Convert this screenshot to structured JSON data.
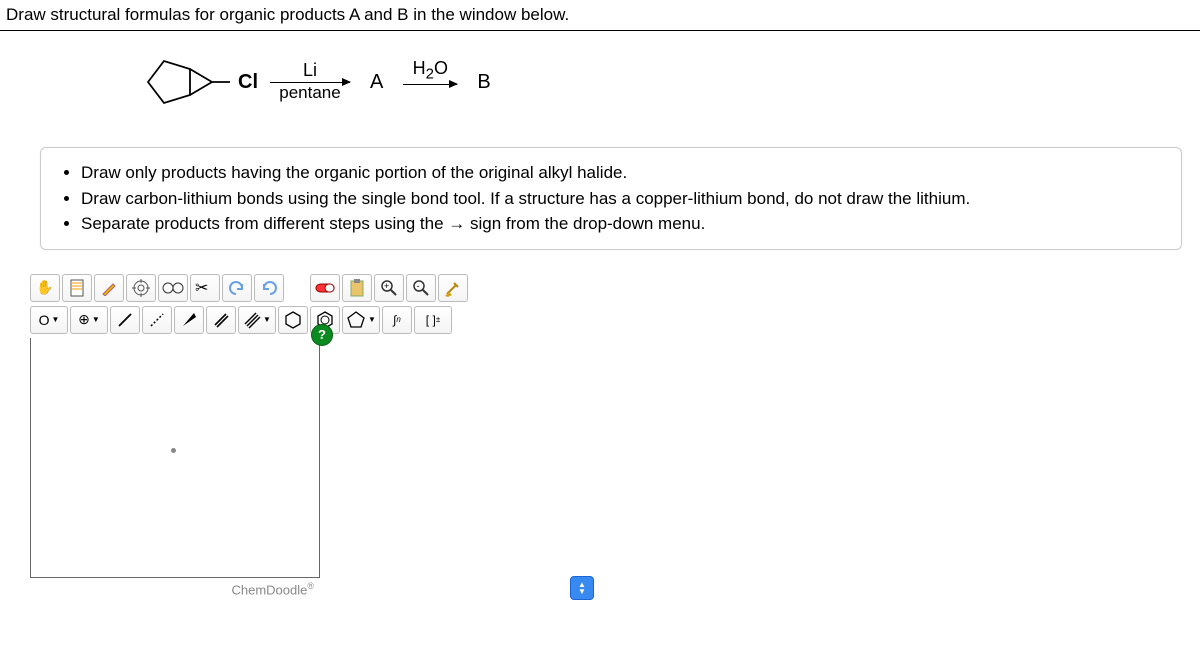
{
  "header": {
    "question": "Draw structural formulas for organic products A and B in the window below."
  },
  "scheme": {
    "reactant_label": "Cl",
    "arrow1_top": "Li",
    "arrow1_bottom": "pentane",
    "product_A": "A",
    "arrow2_top": "H₂O",
    "product_B": "B"
  },
  "instructions": {
    "items": [
      "Draw only products having the organic portion of the original alkyl halide.",
      "Draw carbon-lithium bonds using the single bond tool. If a structure has a copper-lithium bond, do not draw the lithium.",
      "Separate products from different steps using the → sign from the drop-down menu."
    ]
  },
  "toolbar_row1": {
    "hand": "✋",
    "doc": "📄",
    "pencil": "✏",
    "target": "⊛",
    "glasses": "👓",
    "scissors": "✂",
    "undo": "↶",
    "redo": "↷",
    "spacer": "",
    "pill": "💊",
    "paste": "📋",
    "zoomin": "🔍",
    "zoomout": "🔍",
    "broom": "🧹"
  },
  "toolbar_row2": {
    "elem_O": "O",
    "drop1": "▾",
    "plus": "⊕",
    "drop2": "▾",
    "single": "╱",
    "wedge_dot": "⋰",
    "wedge": "◢",
    "double_slash": "⫽",
    "triple": "⫻",
    "drop3": "▾",
    "hex": "⬡",
    "hexf": "⬢",
    "pent": "⬠",
    "drop4": "▾",
    "integral": "∫n",
    "bracket": "[ ]±"
  },
  "footer": {
    "brand": "ChemDoodle"
  }
}
